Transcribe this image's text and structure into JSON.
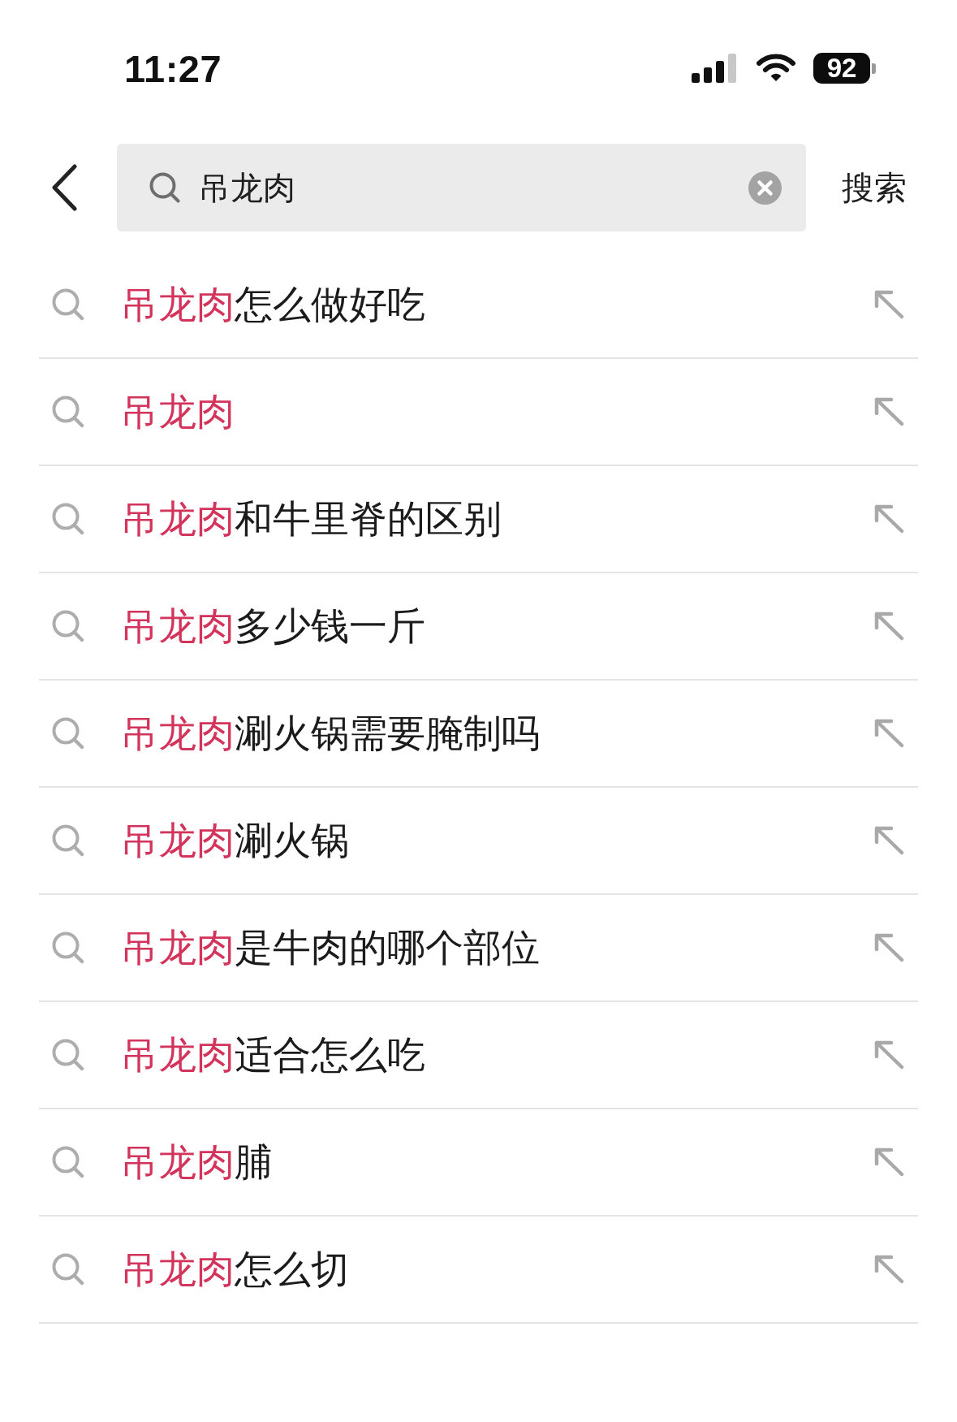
{
  "status_bar": {
    "time": "11:27",
    "battery": "92"
  },
  "search_bar": {
    "value": "吊龙肉",
    "submit_label": "搜索"
  },
  "suggestions": [
    {
      "match": "吊龙肉",
      "rest": "怎么做好吃"
    },
    {
      "match": "吊龙肉"
    },
    {
      "match": "吊龙肉",
      "rest": "和牛里脊的区别"
    },
    {
      "match": "吊龙肉",
      "rest": "多少钱一斤"
    },
    {
      "match": "吊龙肉",
      "rest": "涮火锅需要腌制吗"
    },
    {
      "match": "吊龙肉",
      "rest": "涮火锅"
    },
    {
      "match": "吊龙肉",
      "rest": "是牛肉的哪个部位"
    },
    {
      "match": "吊龙肉",
      "rest": "适合怎么吃"
    },
    {
      "match": "吊龙肉",
      "rest": "脯"
    },
    {
      "match": "吊龙肉",
      "rest": "怎么切"
    }
  ]
}
